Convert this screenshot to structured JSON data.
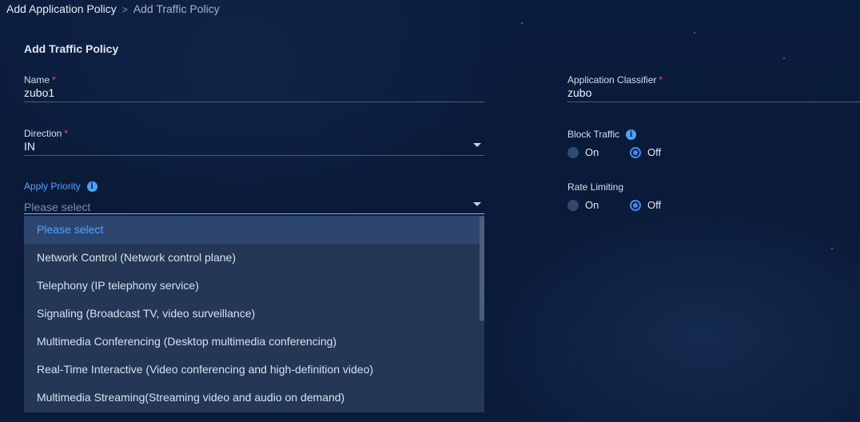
{
  "breadcrumb": {
    "root": "Add Application Policy",
    "separator": ">",
    "current": "Add Traffic Policy"
  },
  "section_title": "Add Traffic Policy",
  "fields": {
    "name": {
      "label": "Name",
      "required": "*",
      "value": "zubo1"
    },
    "direction": {
      "label": "Direction",
      "required": "*",
      "value": "IN"
    },
    "apply_priority": {
      "label": "Apply Priority",
      "placeholder": "Please select",
      "info_icon": "i"
    },
    "application_classifier": {
      "label": "Application Classifier",
      "required": "*",
      "value": "zubo"
    },
    "block_traffic": {
      "label": "Block Traffic",
      "info_icon": "i",
      "options": [
        "On",
        "Off"
      ],
      "selected": "Off"
    },
    "rate_limiting": {
      "label": "Rate Limiting",
      "options": [
        "On",
        "Off"
      ],
      "selected": "Off"
    }
  },
  "priority_dropdown": {
    "items": [
      "Please select",
      "Network Control (Network control plane)",
      "Telephony (IP telephony service)",
      "Signaling (Broadcast TV, video surveillance)",
      "Multimedia Conferencing (Desktop multimedia conferencing)",
      "Real-Time Interactive (Video conferencing and high-definition video)",
      "Multimedia Streaming(Streaming video and audio on demand)"
    ],
    "highlighted_index": 0
  },
  "colors": {
    "background": "#0b1d3d",
    "accent": "#4aa3ff",
    "required": "#ff4d4f",
    "dropdown_bg": "#243856"
  },
  "icons": {
    "select_arrow": "chevron-down-icon",
    "info": "info-icon"
  }
}
